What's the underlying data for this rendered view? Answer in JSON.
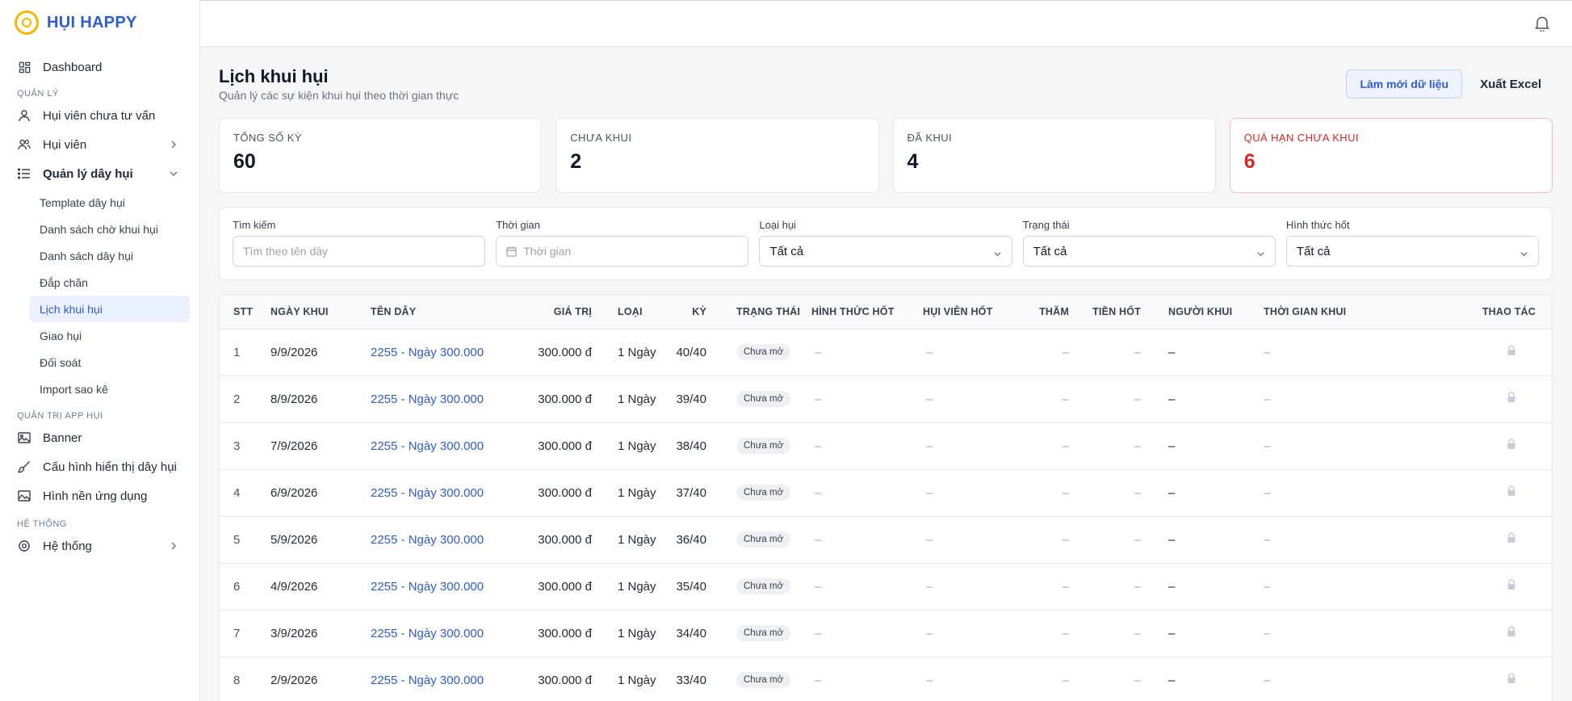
{
  "app": {
    "name": "HỤI HAPPY"
  },
  "sidebar": {
    "dashboard": "Dashboard",
    "section_manage": "QUẢN LÝ",
    "items_manage": {
      "consult": "Hụi viên chưa tư vấn",
      "members": "Hụi viên",
      "manage_lines": "Quản lý dây hụi"
    },
    "sub_items": [
      "Template dây hụi",
      "Danh sách chờ khui hụi",
      "Danh sách dây hụi",
      "Đắp chăn",
      "Lịch khui hụi",
      "Giao hụi",
      "Đối soát",
      "Import sao kê"
    ],
    "section_app": "QUẢN TRỊ APP HỤI",
    "items_app": {
      "banner": "Banner",
      "display_config": "Cấu hình hiển thị dây hụi",
      "wallpaper": "Hình nền ứng dụng"
    },
    "section_system": "HỆ THỐNG",
    "system": "Hệ thống"
  },
  "page": {
    "title": "Lịch khui hụi",
    "subtitle": "Quản lý các sự kiện khui hụi theo thời gian thực",
    "refresh": "Làm mới dữ liệu",
    "export": "Xuất Excel"
  },
  "stats": [
    {
      "label": "TỔNG SỐ KỲ",
      "value": "60"
    },
    {
      "label": "CHƯA KHUI",
      "value": "2"
    },
    {
      "label": "ĐÃ KHUI",
      "value": "4"
    },
    {
      "label": "QUÁ HẠN CHƯA KHUI",
      "value": "6"
    }
  ],
  "filters": {
    "search_label": "Tìm kiếm",
    "search_placeholder": "Tìm theo tên dây",
    "time_label": "Thời gian",
    "time_placeholder": "Thời gian",
    "type_label": "Loại hụi",
    "type_value": "Tất cả",
    "status_label": "Trạng thái",
    "status_value": "Tất cả",
    "form_label": "Hình thức hốt",
    "form_value": "Tất cả"
  },
  "table": {
    "headers": [
      "STT",
      "NGÀY KHUI",
      "TÊN DÂY",
      "GIÁ TRỊ",
      "LOẠI",
      "KỲ",
      "TRẠNG THÁI",
      "HÌNH THỨC HỐT",
      "HỤI VIÊN HỐT",
      "THĂM",
      "TIỀN HỐT",
      "NGƯỜI KHUI",
      "THỜI GIAN KHUI",
      "THAO TÁC"
    ],
    "rows": [
      {
        "stt": "1",
        "date": "9/9/2026",
        "name": "2255 - Ngày 300.000",
        "value": "300.000 đ",
        "type": "1 Ngày",
        "period": "40/40",
        "status": "Chưa mở",
        "form": "–",
        "member": "–",
        "bid": "–",
        "amount": "–",
        "opener": "–",
        "time": "–"
      },
      {
        "stt": "2",
        "date": "8/9/2026",
        "name": "2255 - Ngày 300.000",
        "value": "300.000 đ",
        "type": "1 Ngày",
        "period": "39/40",
        "status": "Chưa mở",
        "form": "–",
        "member": "–",
        "bid": "–",
        "amount": "–",
        "opener": "–",
        "time": "–"
      },
      {
        "stt": "3",
        "date": "7/9/2026",
        "name": "2255 - Ngày 300.000",
        "value": "300.000 đ",
        "type": "1 Ngày",
        "period": "38/40",
        "status": "Chưa mở",
        "form": "–",
        "member": "–",
        "bid": "–",
        "amount": "–",
        "opener": "–",
        "time": "–"
      },
      {
        "stt": "4",
        "date": "6/9/2026",
        "name": "2255 - Ngày 300.000",
        "value": "300.000 đ",
        "type": "1 Ngày",
        "period": "37/40",
        "status": "Chưa mở",
        "form": "–",
        "member": "–",
        "bid": "–",
        "amount": "–",
        "opener": "–",
        "time": "–"
      },
      {
        "stt": "5",
        "date": "5/9/2026",
        "name": "2255 - Ngày 300.000",
        "value": "300.000 đ",
        "type": "1 Ngày",
        "period": "36/40",
        "status": "Chưa mở",
        "form": "–",
        "member": "–",
        "bid": "–",
        "amount": "–",
        "opener": "–",
        "time": "–"
      },
      {
        "stt": "6",
        "date": "4/9/2026",
        "name": "2255 - Ngày 300.000",
        "value": "300.000 đ",
        "type": "1 Ngày",
        "period": "35/40",
        "status": "Chưa mở",
        "form": "–",
        "member": "–",
        "bid": "–",
        "amount": "–",
        "opener": "–",
        "time": "–"
      },
      {
        "stt": "7",
        "date": "3/9/2026",
        "name": "2255 - Ngày 300.000",
        "value": "300.000 đ",
        "type": "1 Ngày",
        "period": "34/40",
        "status": "Chưa mở",
        "form": "–",
        "member": "–",
        "bid": "–",
        "amount": "–",
        "opener": "–",
        "time": "–"
      },
      {
        "stt": "8",
        "date": "2/9/2026",
        "name": "2255 - Ngày 300.000",
        "value": "300.000 đ",
        "type": "1 Ngày",
        "period": "33/40",
        "status": "Chưa mở",
        "form": "–",
        "member": "–",
        "bid": "–",
        "amount": "–",
        "opener": "–",
        "time": "–"
      }
    ]
  },
  "icons": {
    "logo": "logo-icon",
    "bell": "bell-icon",
    "lock": "lock-icon",
    "dashboard": "grid-icon",
    "user": "user-icon",
    "users": "users-icon",
    "list": "list-icon",
    "image": "image-icon",
    "brush": "brush-icon",
    "gear": "gear-icon",
    "calendar": "calendar-icon"
  }
}
